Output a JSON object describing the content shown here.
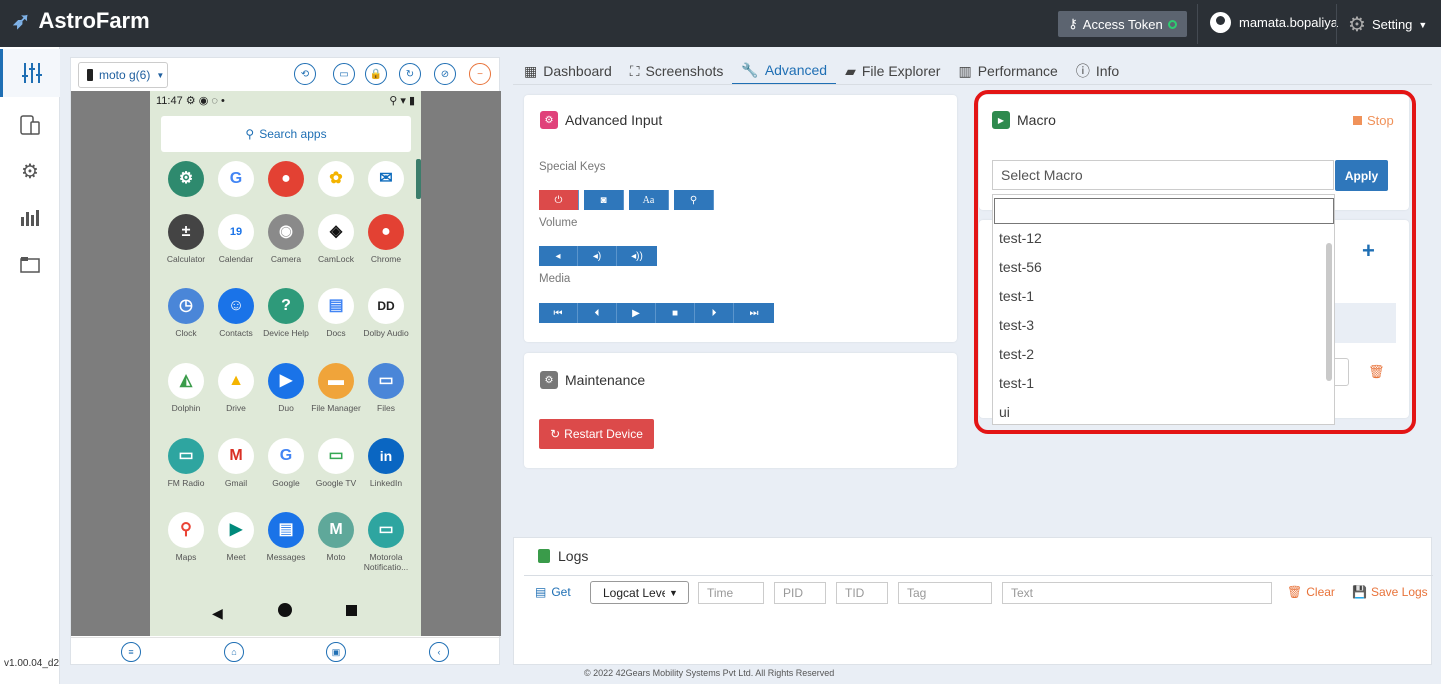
{
  "header": {
    "app_name": "AstroFarm",
    "access_token": "Access Token",
    "user": "mamata.bopaliya",
    "setting": "Setting"
  },
  "version": "v1.00.04_d2",
  "device": {
    "name": "moto g(6)",
    "status_time": "11:47",
    "search_apps": "Search apps",
    "apps": [
      "Calculator",
      "Calendar",
      "Camera",
      "CamLock",
      "Chrome",
      "Clock",
      "Contacts",
      "Device Help",
      "Docs",
      "Dolby Audio",
      "Dolphin",
      "Drive",
      "Duo",
      "File Manager",
      "Files",
      "FM Radio",
      "Gmail",
      "Google",
      "Google TV",
      "LinkedIn",
      "Maps",
      "Meet",
      "Messages",
      "Moto",
      "Motorola Notificatio..."
    ]
  },
  "tabs": [
    "Dashboard",
    "Screenshots",
    "Advanced",
    "File Explorer",
    "Performance",
    "Info"
  ],
  "advanced_input": {
    "title": "Advanced Input",
    "special_keys": "Special Keys",
    "volume": "Volume",
    "media": "Media",
    "aa": "Aa"
  },
  "maintenance": {
    "title": "Maintenance",
    "restart": "Restart Device"
  },
  "macro": {
    "title": "Macro",
    "stop": "Stop",
    "placeholder": "Select Macro",
    "apply": "Apply",
    "options": [
      "test-12",
      "test-56",
      "test-1",
      "test-3",
      "test-2",
      "test-1",
      "ui"
    ]
  },
  "logs": {
    "title": "Logs",
    "get": "Get",
    "level": "Logcat Leve",
    "time": "Time",
    "pid": "PID",
    "tid": "TID",
    "tag": "Tag",
    "text": "Text",
    "clear": "Clear",
    "save": "Save Logs"
  },
  "footer": "© 2022 42Gears Mobility Systems Pvt Ltd. All Rights Reserved",
  "colors": {
    "accent": "#1f6fb4",
    "danger": "#dc4a4a",
    "highlight": "#e31515"
  }
}
